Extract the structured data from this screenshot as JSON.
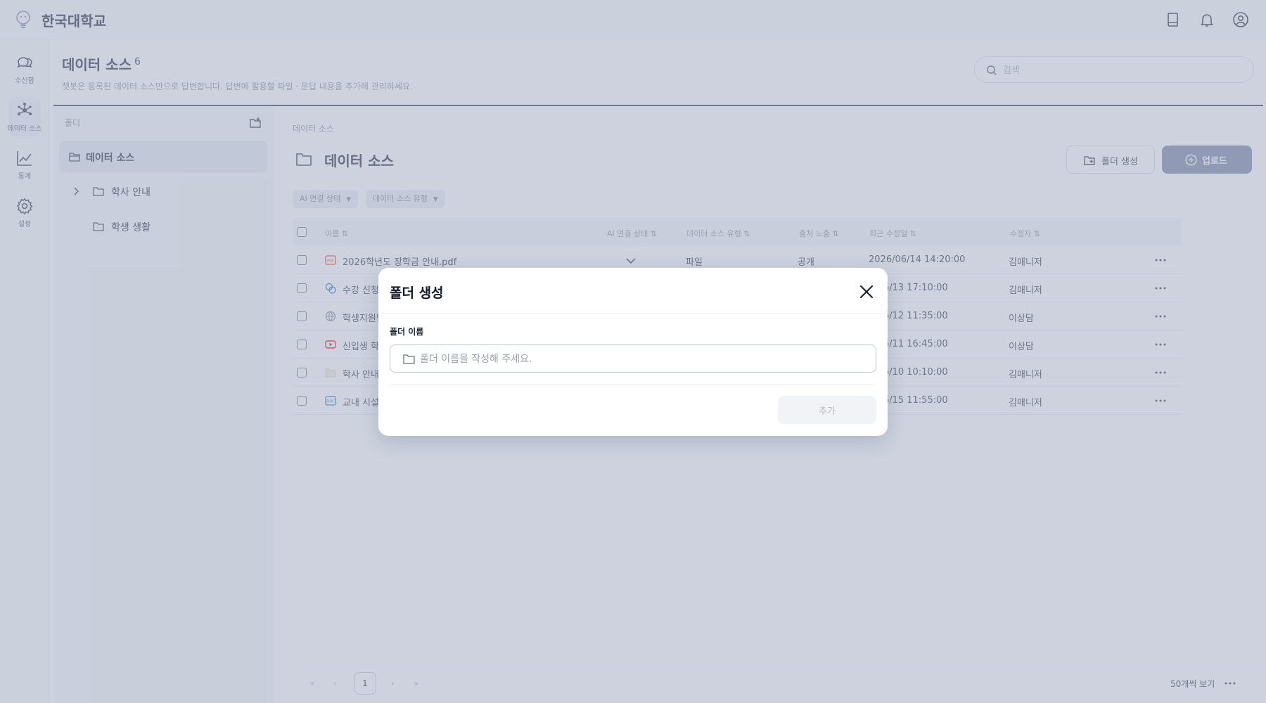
{
  "app": {
    "brand": "한국대학교"
  },
  "topbar": {
    "icons": [
      "book-icon",
      "bell-icon",
      "user-circle-icon"
    ]
  },
  "rail": {
    "items": [
      {
        "label": "수신함",
        "icon": "chat-bubbles-icon"
      },
      {
        "label": "데이터 소스",
        "icon": "network-icon",
        "active": true
      },
      {
        "label": "통계",
        "icon": "line-chart-icon"
      },
      {
        "label": "설정",
        "icon": "gear-icon"
      }
    ]
  },
  "header": {
    "title": "데이터 소스",
    "count": "6",
    "description": "챗봇은 등록된 데이터 소스만으로 답변합니다. 답변에 활용할 파일 · 문답 내용을 추가해 관리하세요.",
    "search_placeholder": "검색"
  },
  "folders": {
    "heading": "폴더",
    "root": "데이터 소스",
    "items": [
      {
        "label": "학사 안내",
        "expandable": true
      },
      {
        "label": "학생 생활",
        "expandable": false
      }
    ]
  },
  "main": {
    "breadcrumb": "데이터 소스",
    "title": "데이터 소스",
    "create_folder_label": "폴더 생성",
    "upload_label": "업로드",
    "filters": [
      "AI 연결 상태",
      "데이터 소스 유형"
    ],
    "columns": {
      "name": "이름",
      "ai": "AI 연결 상태",
      "type": "데이터 소스 유형",
      "exposure": "출처 노출",
      "modified": "최근 수정일",
      "editor": "수정자"
    },
    "rows": [
      {
        "icon": "pdf-file-icon",
        "name": "2026학년도 장학금 안내.pdf",
        "ai": "check",
        "type": "파일",
        "exposure": "공개",
        "modified": "2026/06/14 14:20:00",
        "editor": "김매니저"
      },
      {
        "icon": "faq-icon",
        "name": "수강 신청",
        "ai": "",
        "type": "",
        "exposure": "",
        "modified": "6/06/13 17:10:00",
        "editor": "김매니저"
      },
      {
        "icon": "globe-icon",
        "name": "학생지원팀",
        "ai": "",
        "type": "",
        "exposure": "",
        "modified": "6/06/12 11:35:00",
        "editor": "이상담"
      },
      {
        "icon": "youtube-icon",
        "name": "신입생 학",
        "ai": "",
        "type": "",
        "exposure": "",
        "modified": "6/06/11 16:45:00",
        "editor": "이상담"
      },
      {
        "icon": "folder-icon",
        "name": "학사 안내",
        "ai": "",
        "type": "",
        "exposure": "",
        "modified": "6/06/10 10:10:00",
        "editor": "김매니저"
      },
      {
        "icon": "doc-file-icon",
        "name": "교내 시설",
        "ai": "",
        "type": "",
        "exposure": "",
        "modified": "6/06/15 11:55:00",
        "editor": "김매니저"
      }
    ],
    "pagination": {
      "current_page": "1",
      "per_page_label": "50개씩 보기"
    }
  },
  "modal": {
    "title": "폴더 생성",
    "field_label": "폴더 이름",
    "field_placeholder": "폴더 이름을 작성해 주세요.",
    "add_label": "추가"
  },
  "colors": {
    "accent": "#8a94b0",
    "overlay": "#96a0b9",
    "pdf_red": "#e5533d",
    "youtube_red": "#e02b2b",
    "doc_blue": "#3d7be0"
  }
}
